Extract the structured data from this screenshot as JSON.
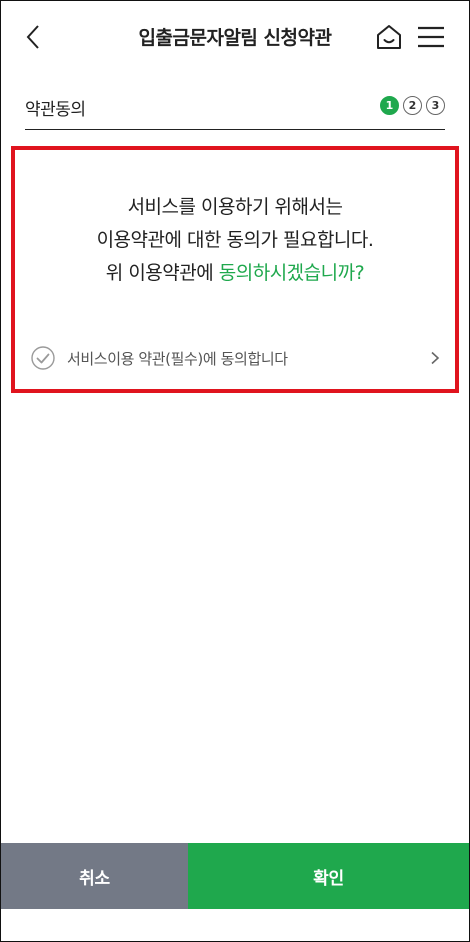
{
  "header": {
    "title": "입출금문자알림 신청약관",
    "icons": {
      "back": "chevron-left-icon",
      "home": "home-icon",
      "menu": "hamburger-menu-icon"
    }
  },
  "section": {
    "title": "약관동의",
    "steps": [
      "1",
      "2",
      "3"
    ],
    "active_step": 1
  },
  "message": {
    "line1": "서비스를 이용하기 위해서는",
    "line2": "이용약관에 대한 동의가 필요합니다.",
    "line3_prefix": "위 이용약관에 ",
    "line3_highlight": "동의하시겠습니까?"
  },
  "agreement": {
    "label": "서비스이용 약관(필수)에 동의합니다",
    "checked": false
  },
  "buttons": {
    "cancel": "취소",
    "confirm": "확인"
  },
  "colors": {
    "accent": "#1fa84d",
    "cancel_bg": "#737986",
    "highlight_border": "#e0141e"
  }
}
